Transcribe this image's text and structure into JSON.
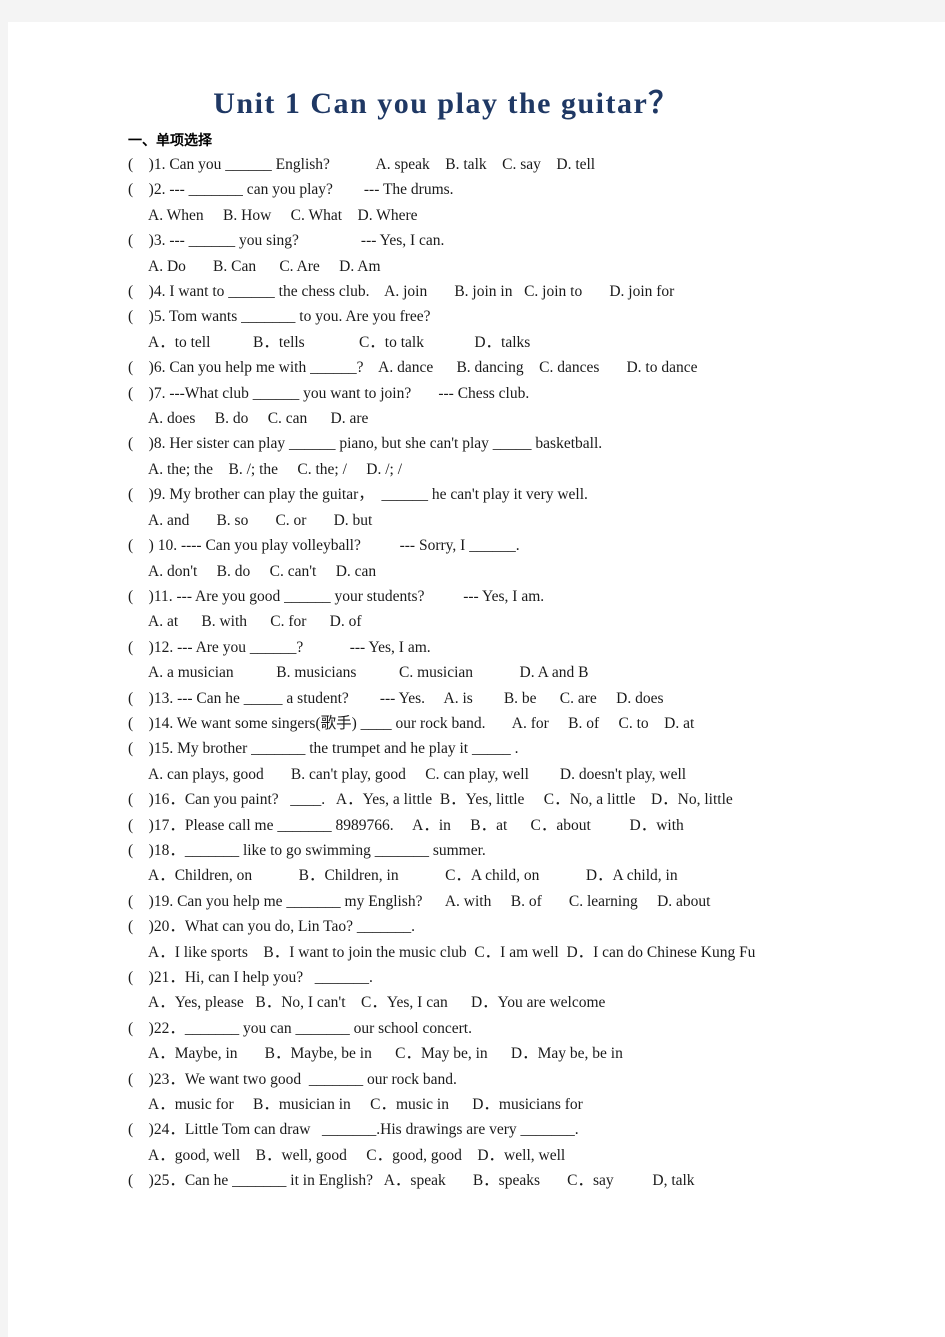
{
  "page": {
    "background": "#f4f4f4",
    "paper": "#ffffff"
  },
  "title": {
    "text": "Unit 1    Can you play the guitar？",
    "color": "#1f3864"
  },
  "section": {
    "heading": "一、单项选择"
  },
  "questions": [
    {
      "number": "1",
      "lines": [
        "(    )1. Can you ______ English?            A. speak    B. talk    C. say    D. tell"
      ]
    },
    {
      "number": "2",
      "lines": [
        "(    )2. --- _______ can you play?        --- The drums.",
        "A. When     B. How     C. What    D. Where"
      ]
    },
    {
      "number": "3",
      "lines": [
        "(    )3. --- ______ you sing?                --- Yes, I can.",
        "A. Do       B. Can      C. Are     D. Am"
      ]
    },
    {
      "number": "4",
      "lines": [
        "(    )4. I want to ______ the chess club.    A. join       B. join in   C. join to       D. join for"
      ]
    },
    {
      "number": "5",
      "lines": [
        "(    )5. Tom wants _______ to you. Are you free?",
        "A．to tell           B．tells              C．to talk             D．talks"
      ]
    },
    {
      "number": "6",
      "lines": [
        "(    )6. Can you help me with ______?    A. dance      B. dancing    C. dances       D. to dance"
      ]
    },
    {
      "number": "7",
      "lines": [
        "(    )7. ---What club ______ you want to join?       --- Chess club.",
        "A. does     B. do     C. can      D. are"
      ]
    },
    {
      "number": "8",
      "lines": [
        "(    )8. Her sister can play ______ piano, but she can't play _____ basketball.",
        "A. the; the    B. /; the     C. the; /     D. /; /"
      ]
    },
    {
      "number": "9",
      "lines": [
        "(    )9. My brother can play the guitar，  ______ he can't play it very well.",
        "A. and       B. so       C. or       D. but"
      ]
    },
    {
      "number": "10",
      "lines": [
        "(    ) 10. ---- Can you play volleyball?          --- Sorry, I ______.",
        "A. don't     B. do     C. can't     D. can"
      ]
    },
    {
      "number": "11",
      "lines": [
        "(    )11. --- Are you good ______ your students?          --- Yes, I am.",
        "A. at      B. with      C. for      D. of"
      ]
    },
    {
      "number": "12",
      "lines": [
        "(    )12. --- Are you ______?            --- Yes, I am.",
        "A. a musician           B. musicians           C. musician            D. A and B"
      ]
    },
    {
      "number": "13",
      "lines": [
        "(    )13. --- Can he _____ a student?        --- Yes.     A. is        B. be      C. are     D. does"
      ]
    },
    {
      "number": "14",
      "lines": [
        "(    )14. We want some singers(歌手) ____ our rock band.       A. for     B. of     C. to    D. at"
      ]
    },
    {
      "number": "15",
      "lines": [
        "(    )15. My brother _______ the trumpet and he play it _____ .",
        "A. can plays, good       B. can't play, good     C. can play, well        D. doesn't play, well"
      ]
    },
    {
      "number": "16",
      "lines": [
        "(    )16．Can you paint?   ____.   A．Yes, a little  B．Yes, little     C．No, a little    D．No, little"
      ]
    },
    {
      "number": "17",
      "lines": [
        "(    )17．Please call me _______ 8989766.     A．in     B．at      C．about          D．with"
      ]
    },
    {
      "number": "18",
      "lines": [
        "(    )18．_______ like to go swimming _______ summer.",
        "A．Children, on            B．Children, in            C．A child, on            D．A child, in"
      ]
    },
    {
      "number": "19",
      "lines": [
        "(    )19. Can you help me _______ my English?      A. with     B. of       C. learning     D. about"
      ]
    },
    {
      "number": "20",
      "lines": [
        "(    )20．What can you do, Lin Tao? _______.",
        "A．I like sports    B．I want to join the music club  C．I am well  D．I can do Chinese Kung Fu"
      ]
    },
    {
      "number": "21",
      "lines": [
        "(    )21．Hi, can I help you?   _______.",
        "A．Yes, please   B．No, I can't    C．Yes, I can      D．You are welcome"
      ]
    },
    {
      "number": "22",
      "lines": [
        "(    )22．_______ you can _______ our school concert.",
        "A．Maybe, in       B．Maybe, be in      C．May be, in      D．May be, be in"
      ]
    },
    {
      "number": "23",
      "lines": [
        "(    )23．We want two good  _______ our rock band.",
        "A．music for     B．musician in     C．music in      D．musicians for"
      ]
    },
    {
      "number": "24",
      "lines": [
        "(    )24．Little Tom can draw   _______.His drawings are very _______.",
        "A．good, well    B．well, good     C．good, good    D．well, well"
      ]
    },
    {
      "number": "25",
      "lines": [
        "(    )25．Can he _______ it in English?   A．speak       B．speaks       C．say          D, talk"
      ]
    }
  ]
}
